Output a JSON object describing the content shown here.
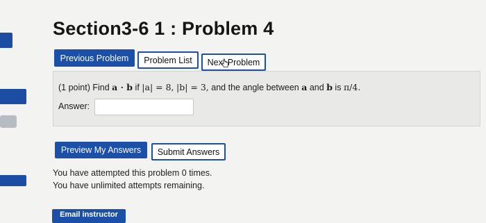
{
  "page": {
    "title": "Section3-6 1 : Problem 4"
  },
  "nav": {
    "previous_label": "Previous Problem",
    "list_label": "Problem List",
    "next_label": "Next Problem"
  },
  "problem": {
    "points": "(1 point)",
    "find_word": "Find",
    "expr_dot": "a · b",
    "if_word": "if",
    "given_a": "|a| = 8,",
    "given_b": "|b| = 3,",
    "angle_text": "and the angle between",
    "vec_a": "a",
    "and_word": "and",
    "vec_b": "b",
    "is_word": "is",
    "angle_value": "π/4.",
    "answer_label": "Answer:",
    "answer_value": ""
  },
  "actions": {
    "preview_label": "Preview My Answers",
    "submit_label": "Submit Answers"
  },
  "status": {
    "attempts_line": "You have attempted this problem 0 times.",
    "remaining_line": "You have unlimited attempts remaining."
  },
  "footer": {
    "email_label": "Email instructor"
  },
  "colors": {
    "accent": "#1c4fa8",
    "background": "#f3f3f1",
    "panel": "#e9e9e7"
  }
}
